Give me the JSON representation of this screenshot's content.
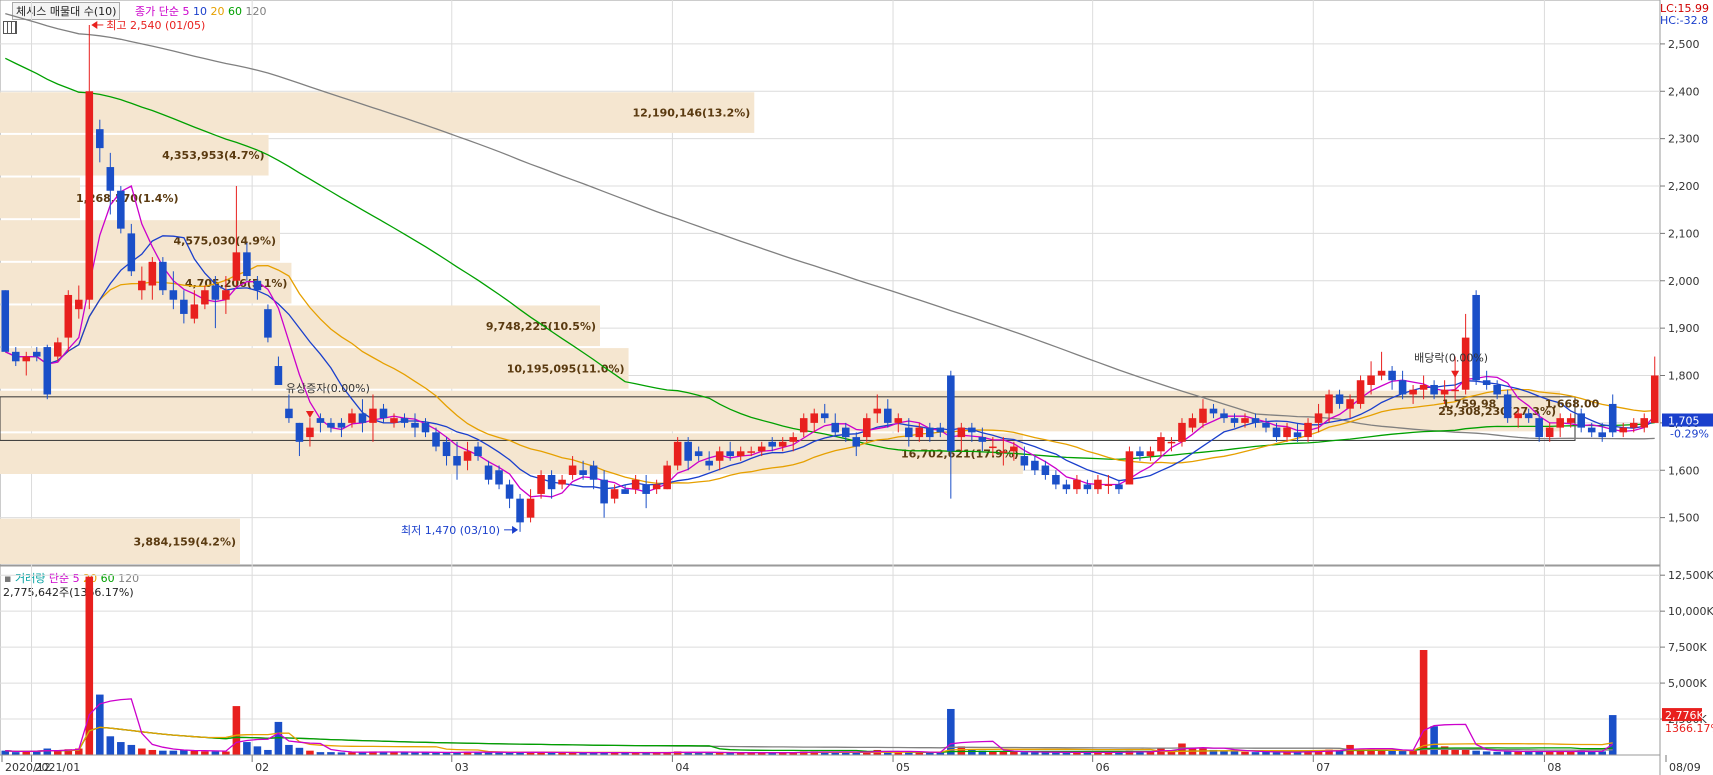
{
  "price_panel": {
    "title": "체시스 매물대 수(10)",
    "legend_prefix": "종가 단순",
    "ma_periods": [
      "5",
      "10",
      "20",
      "60",
      "120"
    ],
    "ma_colors": [
      "#cc00cc",
      "#1a3fcc",
      "#e6a000",
      "#00a000",
      "#808080"
    ],
    "lc_label": "LC:15.99",
    "hc_label": "HC:-32.8",
    "current_price_label": "1,705",
    "current_change_label": "-0.29%",
    "high_annotation": "최고 2,540 (01/05)",
    "low_annotation": "최저 1,470 (03/10)",
    "event_rights": "유상증자(0.00%)",
    "event_dividend": "배당락(0.00%)"
  },
  "volume_panel": {
    "title": "거래량",
    "legend_prefix": "단순",
    "ma_periods": [
      "5",
      "20",
      "60",
      "120"
    ],
    "ma_colors": [
      "#cc00cc",
      "#e6a000",
      "#00a000",
      "#808080"
    ],
    "summary": "2,775,642주(1366.17%)",
    "last_volume_label": "2,776K",
    "last_ratio_label": "1366.17%"
  },
  "colors": {
    "up": "#e8201e",
    "down": "#1a4fc8",
    "profile": "#f5e6d0",
    "profile_text": "#5a3a10",
    "grid": "#dcdcdc"
  },
  "chart_data": [
    {
      "type": "candlestick",
      "title": "체시스 매물대 수(10)",
      "y_axis_ticks": [
        "2,500",
        "2,400",
        "2,300",
        "2,200",
        "2,100",
        "2,000",
        "1,900",
        "1,800",
        "1,700",
        "1,600",
        "1,500"
      ],
      "ylim": [
        1400,
        2580
      ],
      "x_axis_ticks": [
        "2020/12",
        "2021/01",
        "02",
        "03",
        "04",
        "05",
        "06",
        "07",
        "08",
        "08/09"
      ],
      "highest": {
        "value": 2540,
        "date": "01/05"
      },
      "lowest": {
        "value": 1470,
        "date": "03/10"
      },
      "last_close": 1705,
      "last_change_pct": -0.29,
      "price_profile": [
        {
          "range": [
            1400,
            1500
          ],
          "label": "3,884,159(4.2%)",
          "pct": 4.2
        },
        {
          "range": [
            1500,
            1590
          ],
          "label": "",
          "pct": 0
        },
        {
          "range": [
            1590,
            1680
          ],
          "label": "16,702,621(17.9%)",
          "pct": 17.9
        },
        {
          "range": [
            1680,
            1770
          ],
          "label": "25,308,230(27.3%)",
          "pct": 27.3
        },
        {
          "range": [
            1770,
            1860
          ],
          "label": "10,195,095(11.0%)",
          "pct": 11.0
        },
        {
          "range": [
            1860,
            1950
          ],
          "label": "9,748,225(10.5%)",
          "pct": 10.5
        },
        {
          "range": [
            1950,
            2040
          ],
          "label": "4,705,206(5.1%)",
          "pct": 5.1
        },
        {
          "range": [
            2040,
            2130
          ],
          "label": "4,575,030(4.9%)",
          "pct": 4.9
        },
        {
          "range": [
            2130,
            2220
          ],
          "label": "1,268,570(1.4%)",
          "pct": 1.4
        },
        {
          "range": [
            2220,
            2310
          ],
          "label": "4,353,953(4.7%)",
          "pct": 4.7
        },
        {
          "range": [
            2310,
            2400
          ],
          "label": "12,190,146(13.2%)",
          "pct": 13.2
        }
      ],
      "value_area": [
        1663,
        1755
      ],
      "point_labels": [
        "1,759.98",
        "1,668.00"
      ],
      "candles": [
        [
          1980,
          1980,
          1880,
          1850
        ],
        [
          1850,
          1860,
          1820,
          1830
        ],
        [
          1830,
          1850,
          1800,
          1840
        ],
        [
          1850,
          1860,
          1830,
          1840
        ],
        [
          1860,
          1865,
          1750,
          1760
        ],
        [
          1840,
          1880,
          1830,
          1870
        ],
        [
          1880,
          1980,
          1850,
          1970
        ],
        [
          1940,
          1990,
          1920,
          1960
        ],
        [
          1960,
          2540,
          1940,
          2400
        ],
        [
          2320,
          2340,
          2250,
          2280
        ],
        [
          2240,
          2270,
          2140,
          2190
        ],
        [
          2190,
          2200,
          2100,
          2110
        ],
        [
          2100,
          2120,
          2010,
          2020
        ],
        [
          1980,
          2030,
          1960,
          2000
        ],
        [
          1990,
          2050,
          1960,
          2040
        ],
        [
          2040,
          2050,
          1970,
          1980
        ],
        [
          1980,
          2020,
          1940,
          1960
        ],
        [
          1960,
          1980,
          1910,
          1930
        ],
        [
          1920,
          1980,
          1910,
          1950
        ],
        [
          1950,
          1990,
          1940,
          1980
        ],
        [
          1990,
          2010,
          1900,
          1960
        ],
        [
          1960,
          2010,
          1930,
          1980
        ],
        [
          2000,
          2200,
          1990,
          2060
        ],
        [
          2060,
          2080,
          2000,
          2010
        ],
        [
          2000,
          2010,
          1960,
          1980
        ],
        [
          1940,
          1950,
          1870,
          1880
        ],
        [
          1820,
          1840,
          1780,
          1780
        ],
        [
          1730,
          1760,
          1700,
          1710
        ],
        [
          1700,
          1700,
          1630,
          1660
        ],
        [
          1670,
          1710,
          1650,
          1690
        ],
        [
          1710,
          1720,
          1680,
          1700
        ],
        [
          1700,
          1710,
          1680,
          1690
        ],
        [
          1700,
          1710,
          1670,
          1690
        ],
        [
          1700,
          1730,
          1690,
          1720
        ],
        [
          1720,
          1750,
          1680,
          1700
        ],
        [
          1700,
          1760,
          1660,
          1730
        ],
        [
          1730,
          1740,
          1700,
          1710
        ],
        [
          1700,
          1720,
          1690,
          1710
        ],
        [
          1710,
          1720,
          1690,
          1700
        ],
        [
          1700,
          1720,
          1670,
          1690
        ],
        [
          1700,
          1710,
          1670,
          1680
        ],
        [
          1680,
          1690,
          1640,
          1650
        ],
        [
          1660,
          1670,
          1610,
          1630
        ],
        [
          1630,
          1660,
          1580,
          1610
        ],
        [
          1620,
          1660,
          1600,
          1640
        ],
        [
          1650,
          1660,
          1620,
          1630
        ],
        [
          1610,
          1620,
          1570,
          1580
        ],
        [
          1600,
          1610,
          1560,
          1570
        ],
        [
          1570,
          1580,
          1520,
          1540
        ],
        [
          1540,
          1550,
          1470,
          1490
        ],
        [
          1500,
          1560,
          1490,
          1540
        ],
        [
          1550,
          1600,
          1540,
          1590
        ],
        [
          1590,
          1600,
          1540,
          1560
        ],
        [
          1570,
          1590,
          1560,
          1580
        ],
        [
          1590,
          1630,
          1580,
          1610
        ],
        [
          1600,
          1620,
          1580,
          1590
        ],
        [
          1610,
          1620,
          1560,
          1580
        ],
        [
          1580,
          1600,
          1500,
          1530
        ],
        [
          1540,
          1570,
          1530,
          1560
        ],
        [
          1560,
          1570,
          1550,
          1550
        ],
        [
          1560,
          1590,
          1550,
          1580
        ],
        [
          1570,
          1590,
          1520,
          1550
        ],
        [
          1560,
          1580,
          1550,
          1570
        ],
        [
          1560,
          1620,
          1560,
          1610
        ],
        [
          1610,
          1670,
          1600,
          1660
        ],
        [
          1660,
          1670,
          1600,
          1620
        ],
        [
          1640,
          1650,
          1620,
          1630
        ],
        [
          1620,
          1640,
          1600,
          1610
        ],
        [
          1620,
          1650,
          1600,
          1640
        ],
        [
          1640,
          1660,
          1620,
          1630
        ],
        [
          1630,
          1650,
          1620,
          1640
        ],
        [
          1640,
          1650,
          1630,
          1640
        ],
        [
          1640,
          1660,
          1630,
          1650
        ],
        [
          1660,
          1670,
          1640,
          1650
        ],
        [
          1650,
          1670,
          1640,
          1660
        ],
        [
          1660,
          1680,
          1640,
          1670
        ],
        [
          1680,
          1720,
          1670,
          1710
        ],
        [
          1700,
          1730,
          1680,
          1720
        ],
        [
          1720,
          1740,
          1700,
          1710
        ],
        [
          1700,
          1720,
          1670,
          1680
        ],
        [
          1690,
          1700,
          1660,
          1670
        ],
        [
          1670,
          1680,
          1630,
          1650
        ],
        [
          1670,
          1720,
          1660,
          1710
        ],
        [
          1720,
          1760,
          1700,
          1730
        ],
        [
          1730,
          1750,
          1690,
          1700
        ],
        [
          1700,
          1720,
          1680,
          1710
        ],
        [
          1690,
          1710,
          1650,
          1670
        ],
        [
          1670,
          1700,
          1660,
          1690
        ],
        [
          1690,
          1700,
          1660,
          1670
        ],
        [
          1690,
          1700,
          1670,
          1680
        ],
        [
          1800,
          1810,
          1540,
          1640
        ],
        [
          1670,
          1700,
          1640,
          1690
        ],
        [
          1690,
          1700,
          1660,
          1680
        ],
        [
          1670,
          1690,
          1640,
          1660
        ],
        [
          1650,
          1670,
          1630,
          1650
        ],
        [
          1640,
          1670,
          1610,
          1640
        ],
        [
          1640,
          1660,
          1620,
          1650
        ],
        [
          1630,
          1650,
          1600,
          1610
        ],
        [
          1620,
          1630,
          1590,
          1600
        ],
        [
          1610,
          1620,
          1580,
          1590
        ],
        [
          1590,
          1600,
          1560,
          1570
        ],
        [
          1570,
          1580,
          1550,
          1560
        ],
        [
          1560,
          1590,
          1550,
          1580
        ],
        [
          1570,
          1580,
          1550,
          1560
        ],
        [
          1560,
          1590,
          1550,
          1580
        ],
        [
          1570,
          1590,
          1550,
          1570
        ],
        [
          1570,
          1580,
          1550,
          1560
        ],
        [
          1570,
          1650,
          1570,
          1640
        ],
        [
          1640,
          1650,
          1620,
          1630
        ],
        [
          1630,
          1650,
          1620,
          1640
        ],
        [
          1640,
          1680,
          1630,
          1670
        ],
        [
          1660,
          1670,
          1640,
          1660
        ],
        [
          1660,
          1710,
          1650,
          1700
        ],
        [
          1690,
          1720,
          1680,
          1710
        ],
        [
          1700,
          1750,
          1690,
          1730
        ],
        [
          1730,
          1740,
          1710,
          1720
        ],
        [
          1720,
          1730,
          1700,
          1710
        ],
        [
          1710,
          1720,
          1690,
          1700
        ],
        [
          1700,
          1720,
          1690,
          1710
        ],
        [
          1710,
          1720,
          1690,
          1700
        ],
        [
          1700,
          1710,
          1680,
          1690
        ],
        [
          1690,
          1700,
          1660,
          1670
        ],
        [
          1670,
          1700,
          1660,
          1690
        ],
        [
          1680,
          1700,
          1660,
          1670
        ],
        [
          1670,
          1710,
          1660,
          1700
        ],
        [
          1700,
          1740,
          1680,
          1720
        ],
        [
          1720,
          1770,
          1700,
          1760
        ],
        [
          1760,
          1770,
          1730,
          1740
        ],
        [
          1730,
          1760,
          1710,
          1750
        ],
        [
          1740,
          1800,
          1730,
          1790
        ],
        [
          1780,
          1830,
          1760,
          1800
        ],
        [
          1800,
          1850,
          1790,
          1810
        ],
        [
          1810,
          1820,
          1770,
          1790
        ],
        [
          1790,
          1810,
          1750,
          1760
        ],
        [
          1760,
          1780,
          1740,
          1770
        ],
        [
          1770,
          1800,
          1750,
          1780
        ],
        [
          1780,
          1790,
          1750,
          1760
        ],
        [
          1760,
          1790,
          1740,
          1770
        ],
        [
          1770,
          1840,
          1750,
          1770
        ],
        [
          1770,
          1930,
          1760,
          1880
        ],
        [
          1970,
          1980,
          1780,
          1790
        ],
        [
          1790,
          1810,
          1770,
          1780
        ],
        [
          1780,
          1790,
          1750,
          1760
        ],
        [
          1760,
          1770,
          1700,
          1710
        ],
        [
          1710,
          1730,
          1690,
          1720
        ],
        [
          1720,
          1730,
          1700,
          1710
        ],
        [
          1710,
          1720,
          1660,
          1670
        ],
        [
          1670,
          1700,
          1660,
          1690
        ],
        [
          1690,
          1720,
          1670,
          1710
        ],
        [
          1700,
          1720,
          1690,
          1710
        ],
        [
          1720,
          1730,
          1680,
          1690
        ],
        [
          1690,
          1700,
          1670,
          1680
        ],
        [
          1680,
          1700,
          1660,
          1670
        ],
        [
          1740,
          1760,
          1670,
          1680
        ],
        [
          1680,
          1700,
          1670,
          1690
        ],
        [
          1690,
          1710,
          1680,
          1700
        ],
        [
          1690,
          1720,
          1680,
          1710
        ],
        [
          1700,
          1840,
          1700,
          1800
        ]
      ]
    },
    {
      "type": "bar",
      "title": "거래량",
      "y_axis_ticks": [
        "12,500K",
        "10,000K",
        "7,500K",
        "5,000K",
        "2,500K"
      ],
      "ylim": [
        0,
        13000000
      ],
      "last_volume": 2775642,
      "last_ratio_pct": 1366.17,
      "volumes": [
        300000,
        200000,
        250000,
        300000,
        450000,
        300000,
        400000,
        450000,
        12400000,
        4200000,
        1300000,
        900000,
        700000,
        450000,
        350000,
        300000,
        300000,
        350000,
        280000,
        250000,
        240000,
        240000,
        3400000,
        900000,
        600000,
        350000,
        2300000,
        700000,
        500000,
        300000,
        200000,
        200000,
        180000,
        180000,
        200000,
        250000,
        220000,
        200000,
        180000,
        170000,
        200000,
        180000,
        170000,
        200000,
        220000,
        190000,
        180000,
        170000,
        160000,
        220000,
        200000,
        180000,
        160000,
        150000,
        170000,
        160000,
        150000,
        200000,
        160000,
        150000,
        170000,
        160000,
        150000,
        180000,
        250000,
        200000,
        160000,
        150000,
        160000,
        170000,
        160000,
        150000,
        160000,
        170000,
        160000,
        170000,
        240000,
        250000,
        210000,
        190000,
        180000,
        200000,
        250000,
        350000,
        260000,
        200000,
        190000,
        180000,
        170000,
        160000,
        3200000,
        600000,
        400000,
        300000,
        250000,
        220000,
        210000,
        200000,
        190000,
        180000,
        190000,
        170000,
        180000,
        170000,
        190000,
        180000,
        170000,
        300000,
        250000,
        220000,
        500000,
        300000,
        800000,
        500000,
        450000,
        350000,
        300000,
        250000,
        220000,
        200000,
        210000,
        190000,
        200000,
        220000,
        260000,
        300000,
        380000,
        300000,
        700000,
        450000,
        400000,
        350000,
        300000,
        280000,
        300000,
        7300000,
        2000000,
        600000,
        400000,
        350000,
        300000,
        250000,
        220000,
        240000,
        230000,
        260000,
        280000,
        220000,
        240000,
        230000,
        300000,
        230000,
        250000,
        2775642
      ]
    }
  ]
}
